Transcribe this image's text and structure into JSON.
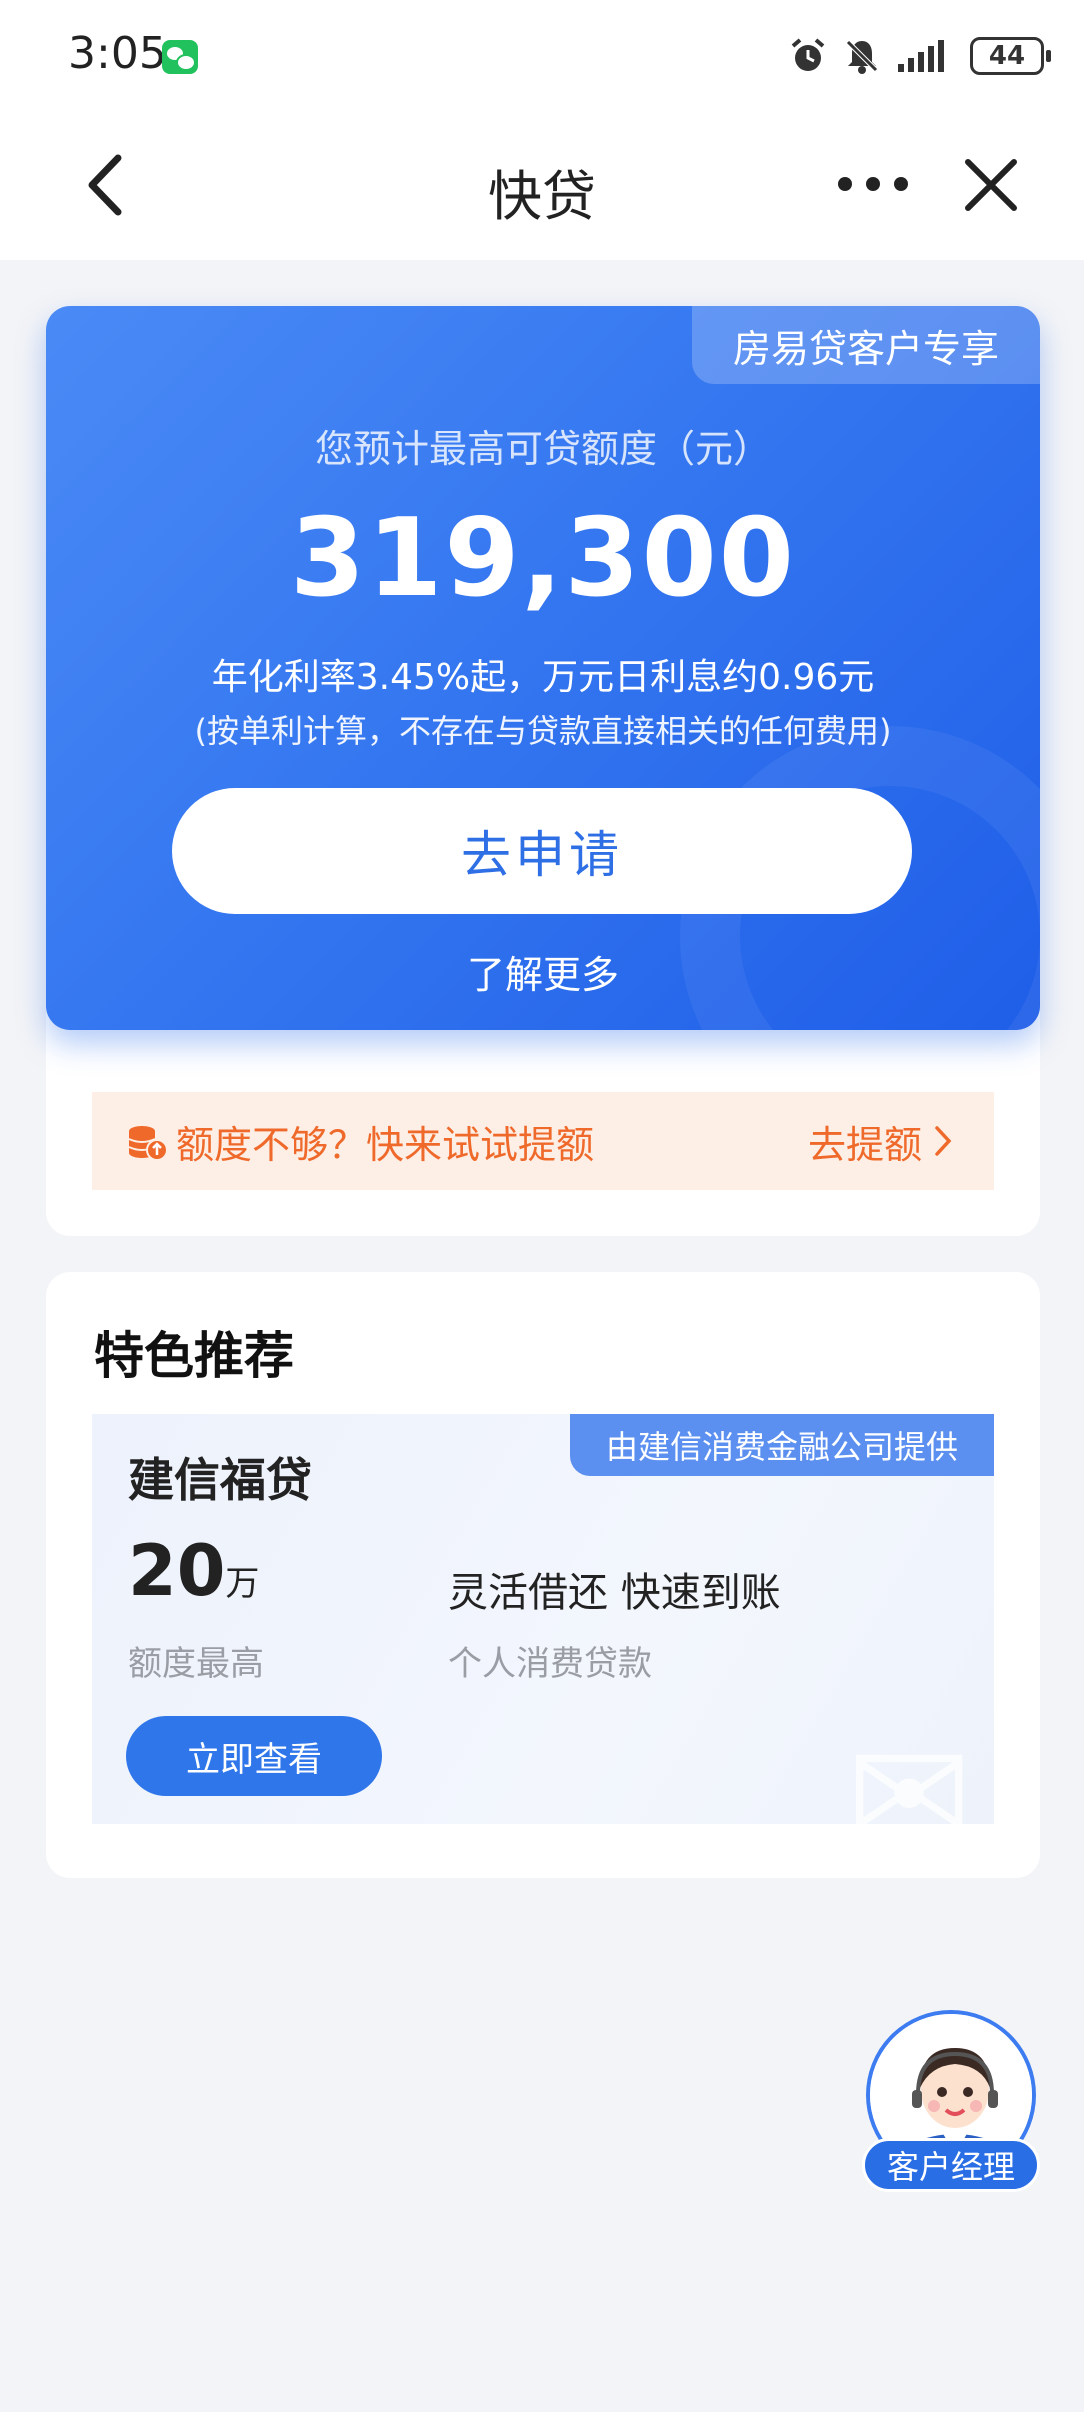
{
  "status": {
    "time": "3:05",
    "battery": "44"
  },
  "nav": {
    "title": "快贷"
  },
  "hero": {
    "badge": "房易贷客户专享",
    "label": "您预计最高可贷额度（元）",
    "amount": "319,300",
    "rate": "年化利率3.45%起，万元日利息约0.96元",
    "note": "(按单利计算，不存在与贷款直接相关的任何费用)",
    "apply_label": "去申请",
    "learn_more": "了解更多"
  },
  "boost": {
    "text": "额度不够？快来试试提额",
    "link": "去提额"
  },
  "recommend": {
    "title": "特色推荐",
    "tag": "由建信消费金融公司提供",
    "product": {
      "name": "建信福贷",
      "amount_num": "20",
      "amount_unit": "万",
      "amount_label": "额度最高",
      "feature": "灵活借还 快速到账",
      "feature_label": "个人消费贷款",
      "button": "立即查看"
    }
  },
  "manager": {
    "label": "客户经理"
  },
  "colors": {
    "primary": "#2f6fe6",
    "accent_orange": "#ef6a2a",
    "page_bg": "#f3f4f7"
  }
}
